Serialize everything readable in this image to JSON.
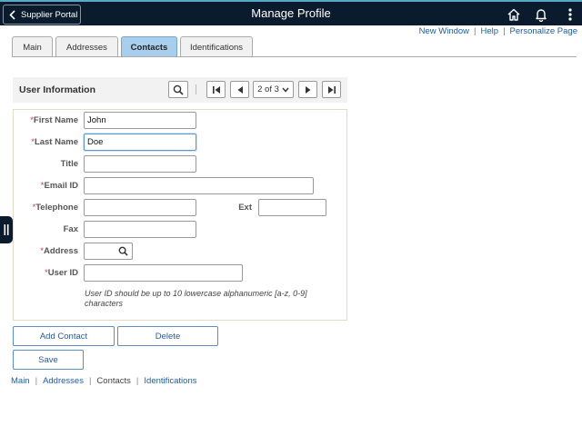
{
  "header": {
    "back_label": "Supplier Portal",
    "title": "Manage Profile",
    "icons": [
      "home-icon",
      "bell-icon",
      "kebab-menu-icon"
    ]
  },
  "top_links": {
    "new_window": "New Window",
    "sep": "|",
    "help": "Help",
    "personalize": "Personalize Page"
  },
  "tabs": [
    {
      "label": "Main",
      "active": false
    },
    {
      "label": "Addresses",
      "active": false
    },
    {
      "label": "Contacts",
      "active": true
    },
    {
      "label": "Identifications",
      "active": false
    }
  ],
  "section": {
    "title": "User Information",
    "pager": "2 of 3",
    "icons": [
      "search-icon",
      "first-page-icon",
      "prev-icon",
      "next-icon",
      "last-page-icon"
    ]
  },
  "form": {
    "required_mark": "*",
    "first_name": {
      "label": "First Name",
      "value": "John"
    },
    "last_name": {
      "label": "Last Name",
      "value": "Doe"
    },
    "title": {
      "label": "Title",
      "value": ""
    },
    "email": {
      "label": "Email ID",
      "value": ""
    },
    "telephone": {
      "label": "Telephone",
      "value": ""
    },
    "ext": {
      "label": "Ext",
      "value": ""
    },
    "fax": {
      "label": "Fax",
      "value": ""
    },
    "address": {
      "label": "Address",
      "value": ""
    },
    "user_id": {
      "label": "User ID",
      "value": ""
    },
    "hint": "User ID should be up to 10 lowercase alphanumeric [a-z, 0-9] characters"
  },
  "buttons": {
    "add_contact": "Add Contact",
    "delete": "Delete",
    "save": "Save"
  },
  "bottom_links": {
    "main": "Main",
    "addresses": "Addresses",
    "contacts": "Contacts",
    "identifications": "Identifications",
    "sep": "|"
  },
  "colors": {
    "header_bg": "#0b1b2e",
    "active_tab": "#a9cdec",
    "link": "#1e5fa0",
    "required": "#c04040"
  }
}
